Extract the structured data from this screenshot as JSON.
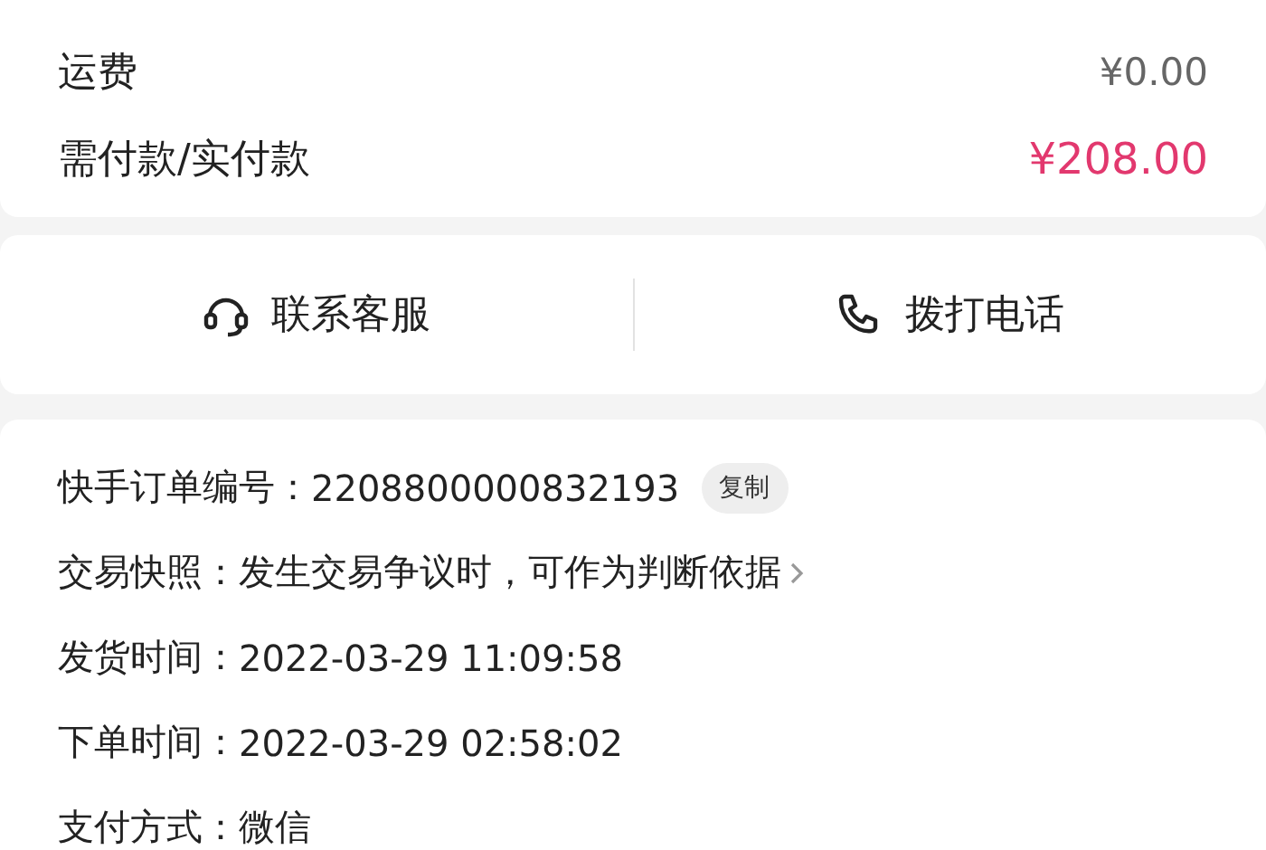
{
  "fees": [
    {
      "label": "运费",
      "value": "¥0.00",
      "highlight": false
    },
    {
      "label": "需付款/实付款",
      "value": "¥208.00",
      "highlight": true
    }
  ],
  "actions": [
    {
      "kind": "headset",
      "label": "联系客服"
    },
    {
      "kind": "phone",
      "label": "拨打电话"
    }
  ],
  "details": [
    {
      "label": "快手订单编号：",
      "value": "2208800000832193",
      "button": "复制",
      "link": false
    },
    {
      "label": "交易快照：",
      "value": "发生交易争议时，可作为判断依据",
      "link": true
    },
    {
      "label": "发货时间：",
      "value": "2022-03-29 11:09:58",
      "link": false
    },
    {
      "label": "下单时间：",
      "value": "2022-03-29 02:58:02",
      "link": false
    },
    {
      "label": "支付方式：",
      "value": "微信",
      "link": false
    }
  ]
}
